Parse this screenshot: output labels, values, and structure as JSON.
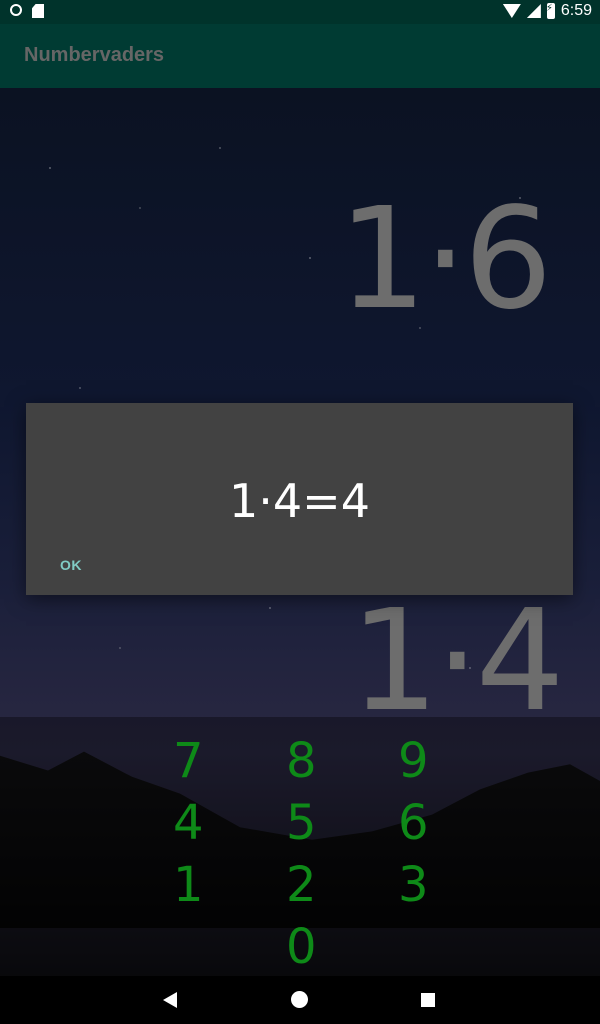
{
  "status_bar": {
    "time": "6:59"
  },
  "app_bar": {
    "title": "Numbervaders"
  },
  "falling_equations": [
    "1·6",
    "1·4"
  ],
  "dialog": {
    "message": "1·4=4",
    "ok_label": "OK"
  },
  "keypad": {
    "k7": "7",
    "k8": "8",
    "k9": "9",
    "k4": "4",
    "k5": "5",
    "k6": "6",
    "k1": "1",
    "k2": "2",
    "k3": "3",
    "k0": "0"
  },
  "icons": {
    "status_left": [
      "notification-circle-icon",
      "sd-card-icon"
    ],
    "status_right": [
      "wifi-icon",
      "cell-signal-icon",
      "battery-charging-icon"
    ],
    "nav": [
      "back-icon",
      "home-icon",
      "recents-icon"
    ]
  },
  "colors": {
    "app_bar": "#003b33",
    "status_bar": "#00332b",
    "dialog": "#424242",
    "keypad_digit": "#0e8a18",
    "falling_digit": "#6d6d6d",
    "ok_text": "#80cbc4"
  }
}
